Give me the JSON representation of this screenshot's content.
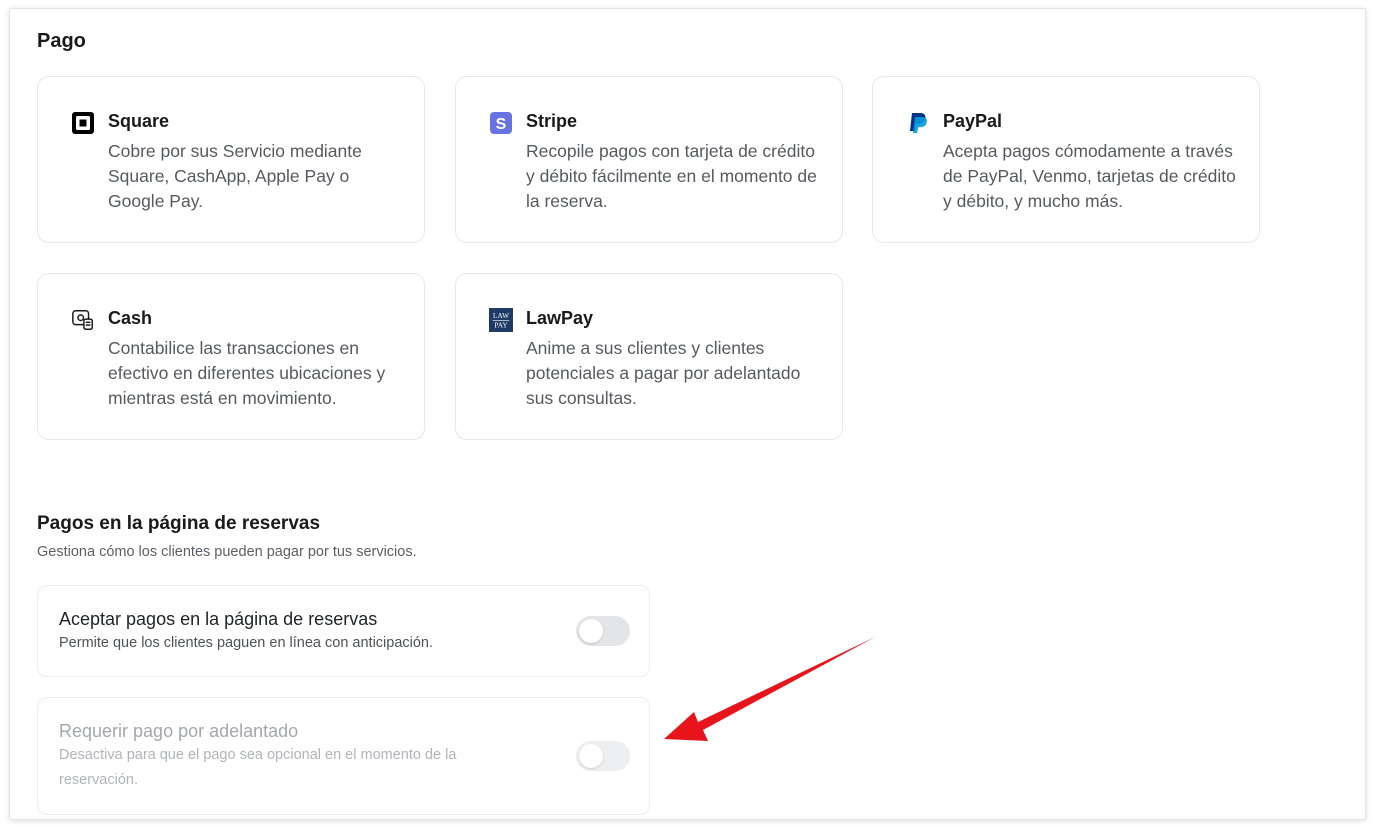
{
  "payment": {
    "section_title": "Pago",
    "providers": [
      {
        "name": "Square",
        "description": "Cobre por sus Servicio mediante Square, CashApp, Apple Pay o Google Pay.",
        "icon": "square-logo-icon"
      },
      {
        "name": "Stripe",
        "description": "Recopile pagos con tarjeta de crédito y débito fácilmente en el momento de la reserva.",
        "icon": "stripe-logo-icon",
        "color": "#6772e5"
      },
      {
        "name": "PayPal",
        "description": "Acepta pagos cómodamente a través de PayPal, Venmo, tarjetas de crédito y débito, y mucho más.",
        "icon": "paypal-logo-icon",
        "color": "#003087"
      },
      {
        "name": "Cash",
        "description": "Contabilice las transacciones en efectivo en diferentes ubicaciones y mientras está en movimiento.",
        "icon": "cash-register-icon"
      },
      {
        "name": "LawPay",
        "description": "Anime a sus clientes y clientes potenciales a pagar por adelantado sus consultas.",
        "icon": "lawpay-logo-icon",
        "logo_text": [
          "LAW",
          "PAY"
        ],
        "color": "#1e3a66"
      }
    ]
  },
  "booking_payments": {
    "title": "Pagos en la página de reservas",
    "description": "Gestiona cómo los clientes pueden pagar por tus servicios.",
    "settings": [
      {
        "title": "Aceptar pagos en la página de reservas",
        "description": "Permite que los clientes paguen en línea con anticipación.",
        "enabled": false,
        "disabled": false
      },
      {
        "title": "Requerir pago por adelantado",
        "description": "Desactiva para que el pago sea opcional en el momento de la reservación.",
        "enabled": false,
        "disabled": true
      }
    ]
  },
  "annotation": {
    "arrow_color": "#e8141b"
  }
}
